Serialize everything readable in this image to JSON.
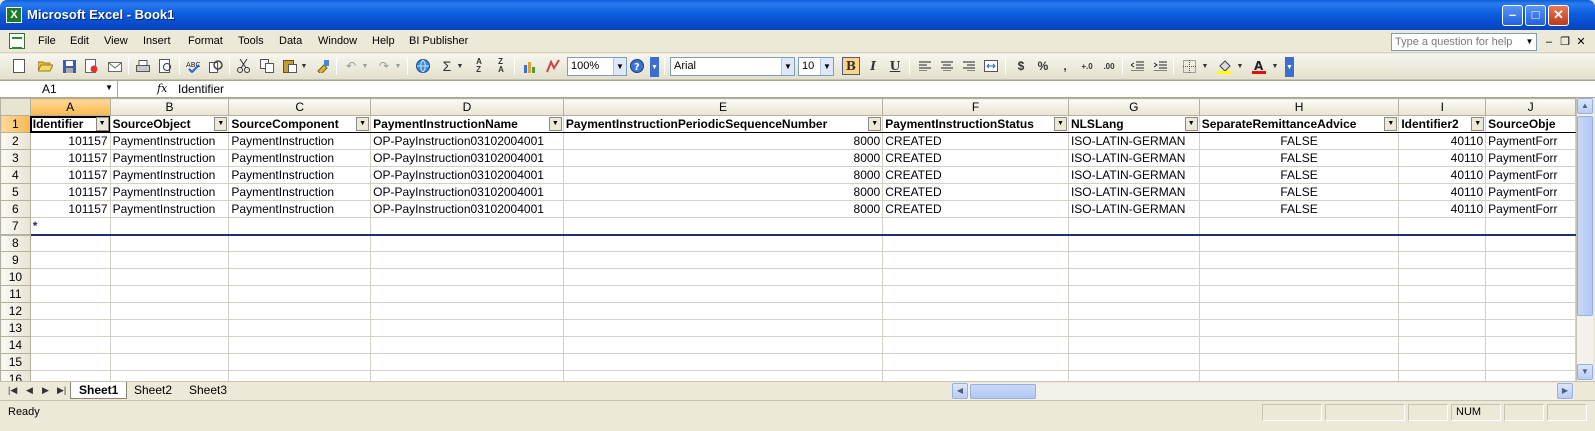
{
  "window": {
    "title": "Microsoft Excel - Book1"
  },
  "menu": [
    "File",
    "Edit",
    "View",
    "Insert",
    "Format",
    "Tools",
    "Data",
    "Window",
    "Help",
    "BI Publisher"
  ],
  "help_placeholder": "Type a question for help",
  "toolbar": {
    "zoom": "100%",
    "font": "Arial",
    "size": "10",
    "bold": "B",
    "italic": "I",
    "underline": "U",
    "currency": "$",
    "percent": "%",
    "comma": ","
  },
  "formula": {
    "cell_ref": "A1",
    "fx": "fx",
    "content": "Identifier"
  },
  "columns": [
    "A",
    "B",
    "C",
    "D",
    "E",
    "F",
    "G",
    "H",
    "I",
    "J"
  ],
  "rows": {
    "r1": [
      "Identifier",
      "SourceObject",
      "SourceComponent",
      "PaymentInstructionName",
      "PaymentInstructionPeriodicSequenceNumber",
      "PaymentInstructionStatus",
      "NLSLang",
      "SeparateRemittanceAdvice",
      "Identifier2",
      "SourceObje"
    ],
    "r2": [
      "101157",
      "PaymentInstruction",
      "PaymentInstruction",
      "OP-PayInstruction03102004001",
      "8000",
      "CREATED",
      "ISO-LATIN-GERMAN",
      "FALSE",
      "40110",
      "PaymentForr"
    ],
    "r3": [
      "101157",
      "PaymentInstruction",
      "PaymentInstruction",
      "OP-PayInstruction03102004001",
      "8000",
      "CREATED",
      "ISO-LATIN-GERMAN",
      "FALSE",
      "40110",
      "PaymentForr"
    ],
    "r4": [
      "101157",
      "PaymentInstruction",
      "PaymentInstruction",
      "OP-PayInstruction03102004001",
      "8000",
      "CREATED",
      "ISO-LATIN-GERMAN",
      "FALSE",
      "40110",
      "PaymentForr"
    ],
    "r5": [
      "101157",
      "PaymentInstruction",
      "PaymentInstruction",
      "OP-PayInstruction03102004001",
      "8000",
      "CREATED",
      "ISO-LATIN-GERMAN",
      "FALSE",
      "40110",
      "PaymentForr"
    ],
    "r6": [
      "101157",
      "PaymentInstruction",
      "PaymentInstruction",
      "OP-PayInstruction03102004001",
      "8000",
      "CREATED",
      "ISO-LATIN-GERMAN",
      "FALSE",
      "40110",
      "PaymentForr"
    ],
    "r7_marker": "*"
  },
  "row_numbers": [
    "1",
    "2",
    "3",
    "4",
    "5",
    "6",
    "7",
    "8",
    "9",
    "10",
    "11",
    "12",
    "13",
    "14",
    "15",
    "16"
  ],
  "sheets": [
    "Sheet1",
    "Sheet2",
    "Sheet3"
  ],
  "status": {
    "text": "Ready",
    "num": "NUM"
  }
}
